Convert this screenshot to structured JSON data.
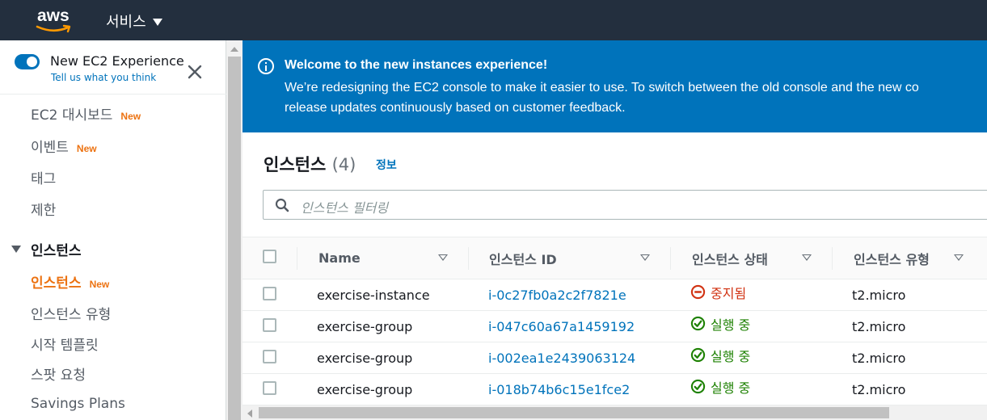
{
  "topnav": {
    "logo_text": "aws",
    "services_label": "서비스"
  },
  "sidebar": {
    "experience": {
      "title": "New EC2 Experience",
      "link": "Tell us what you think",
      "toggle_on": true
    },
    "items": [
      {
        "label": "EC2 대시보드",
        "badge": "New"
      },
      {
        "label": "이벤트",
        "badge": "New"
      },
      {
        "label": "태그",
        "badge": ""
      },
      {
        "label": "제한",
        "badge": ""
      }
    ],
    "section": {
      "label": "인스턴스",
      "items": [
        {
          "label": "인스턴스",
          "badge": "New",
          "active": true
        },
        {
          "label": "인스턴스 유형",
          "badge": ""
        },
        {
          "label": "시작 템플릿",
          "badge": ""
        },
        {
          "label": "스팟 요청",
          "badge": ""
        },
        {
          "label": "Savings Plans",
          "badge": ""
        }
      ]
    }
  },
  "banner": {
    "title": "Welcome to the new instances experience!",
    "line1": "We’re redesigning the EC2 console to make it easier to use. To switch between the old console and the new co",
    "line2": "release updates continuously based on customer feedback."
  },
  "panel": {
    "title": "인스턴스",
    "count": "(4)",
    "info_link": "정보",
    "search_placeholder": "인스턴스 필터링"
  },
  "table": {
    "columns": [
      "Name",
      "인스턴스 ID",
      "인스턴스 상태",
      "인스턴스 유형"
    ],
    "rows": [
      {
        "name": "exercise-instance",
        "id": "i-0c27fb0a2c2f7821e",
        "state": "중지됨",
        "state_kind": "stopped",
        "type": "t2.micro"
      },
      {
        "name": "exercise-group",
        "id": "i-047c60a67a1459192",
        "state": "실행 중",
        "state_kind": "running",
        "type": "t2.micro"
      },
      {
        "name": "exercise-group",
        "id": "i-002ea1e2439063124",
        "state": "실행 중",
        "state_kind": "running",
        "type": "t2.micro"
      },
      {
        "name": "exercise-group",
        "id": "i-018b74b6c15e1fce2",
        "state": "실행 중",
        "state_kind": "running",
        "type": "t2.micro"
      }
    ]
  },
  "colors": {
    "nav_bg": "#232f3e",
    "accent": "#0073bb",
    "orange": "#ec7211",
    "stopped": "#d13212",
    "running": "#1d8102"
  }
}
